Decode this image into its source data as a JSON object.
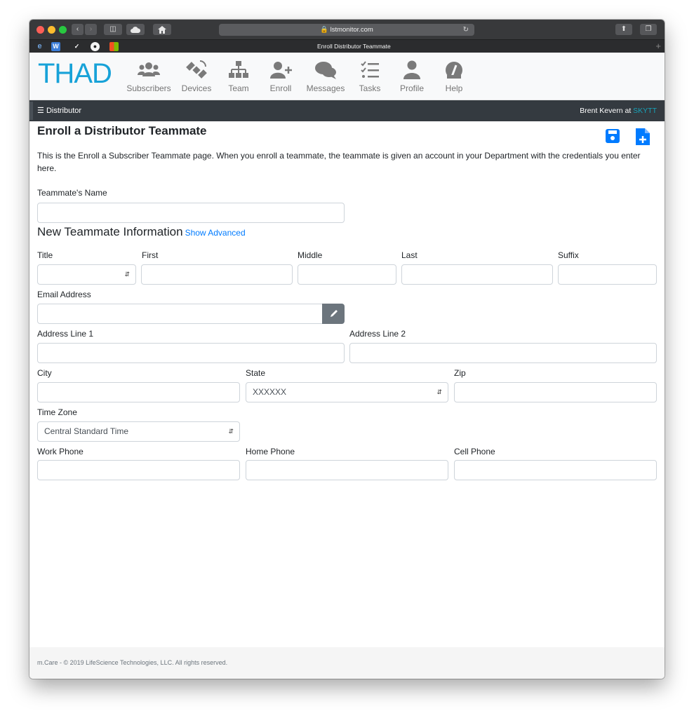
{
  "browser": {
    "url": "lstmonitor.com",
    "tab_title": "Enroll Distributor Teammate"
  },
  "app": {
    "logo": "THAD",
    "nav": [
      {
        "label": "Subscribers",
        "icon": "users-icon"
      },
      {
        "label": "Devices",
        "icon": "satellite-icon"
      },
      {
        "label": "Team",
        "icon": "sitemap-icon"
      },
      {
        "label": "Enroll",
        "icon": "user-plus-icon"
      },
      {
        "label": "Messages",
        "icon": "comments-icon"
      },
      {
        "label": "Tasks",
        "icon": "tasks-icon"
      },
      {
        "label": "Profile",
        "icon": "user-icon"
      },
      {
        "label": "Help",
        "icon": "gauge-icon"
      }
    ]
  },
  "distbar": {
    "menu_label": "Distributor",
    "user_prefix": "Brent Kevern at ",
    "company": "SKYTT"
  },
  "page": {
    "title": "Enroll a Distributor Teammate",
    "description": "This is the Enroll a Subscriber Teammate page. When you enroll a teammate, the teammate is given an account in your Department with the credentials you enter here.",
    "teammate_name_label": "Teammate's Name",
    "section_title": "New Teammate Information",
    "show_advanced": "Show Advanced"
  },
  "form": {
    "title_label": "Title",
    "first_label": "First",
    "middle_label": "Middle",
    "last_label": "Last",
    "suffix_label": "Suffix",
    "email_label": "Email Address",
    "address1_label": "Address Line 1",
    "address2_label": "Address Line 2",
    "city_label": "City",
    "state_label": "State",
    "state_value": "XXXXXX",
    "zip_label": "Zip",
    "timezone_label": "Time Zone",
    "timezone_value": "Central Standard Time",
    "work_phone_label": "Work Phone",
    "home_phone_label": "Home Phone",
    "cell_phone_label": "Cell Phone"
  },
  "footer": {
    "text": "m.Care - © 2019 LifeScience Technologies, LLC. All rights reserved."
  },
  "colors": {
    "brand": "#17a2d8",
    "primary": "#007bff",
    "dark_bar": "#343a40"
  }
}
